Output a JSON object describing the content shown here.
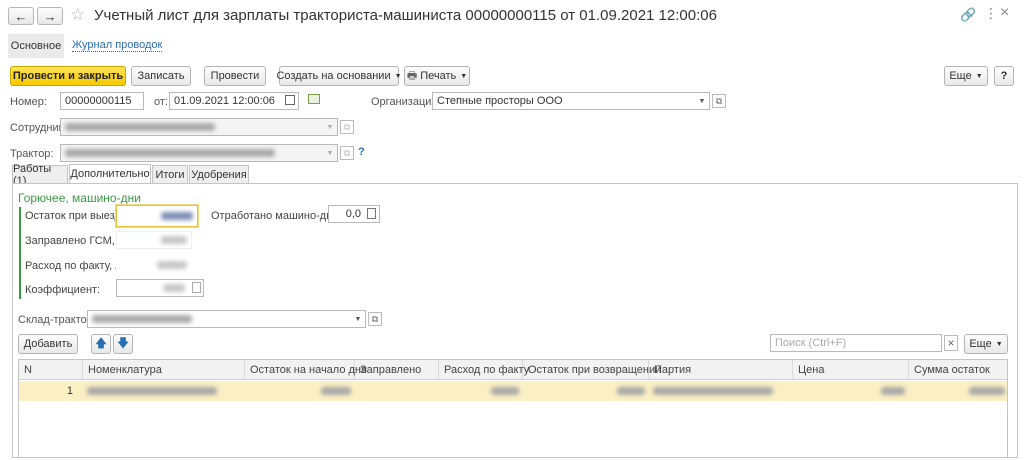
{
  "window": {
    "title": "Учетный лист для зарплаты тракториста-машиниста 00000000115 от 01.09.2021 12:00:06"
  },
  "nav_tabs": [
    {
      "label": "Основное"
    },
    {
      "label": "Журнал проводок"
    }
  ],
  "toolbar": {
    "post_close": "Провести и закрыть",
    "save": "Записать",
    "post": "Провести",
    "create_based": "Создать на основании",
    "print": "Печать",
    "more": "Еще",
    "help": "?"
  },
  "header": {
    "number_label": "Номер:",
    "number_value": "00000000115",
    "date_label": "от:",
    "date_value": "01.09.2021 12:00:06",
    "org_label": "Организация:",
    "org_value": "Степные просторы ООО",
    "employee_label": "Сотрудник:",
    "tractor_label": "Трактор:",
    "tractor_help": "?"
  },
  "doc_tabs": [
    {
      "label": "Работы (1)"
    },
    {
      "label": "Дополнительно"
    },
    {
      "label": "Итоги"
    },
    {
      "label": "Удобрения"
    }
  ],
  "fuel": {
    "group_title": "Горючее, машино-дни",
    "remaining_label": "Остаток при выезде:",
    "refueled_label": "Заправлено ГСМ, л:",
    "actual_label": "Расход по факту, л:",
    "coef_label": "Коэффициент:",
    "machine_days_label": "Отработано машино-дней:",
    "machine_days_value": "0,0"
  },
  "warehouse": {
    "label": "Склад-трактор:"
  },
  "table_toolbar": {
    "add": "Добавить",
    "search_placeholder": "Поиск (Ctrl+F)",
    "more": "Еще"
  },
  "table": {
    "columns": [
      "N",
      "Номенклатура",
      "Остаток на начало дня",
      "Заправлено",
      "Расход по факту",
      "Остаток при возвращении",
      "Партия",
      "Цена",
      "Сумма остаток"
    ],
    "rows": [
      {
        "n": "1"
      }
    ]
  },
  "colors": {
    "accent_yellow": "#f5c900",
    "group_green": "#3a9a45",
    "selected_row": "#fbefc4"
  }
}
